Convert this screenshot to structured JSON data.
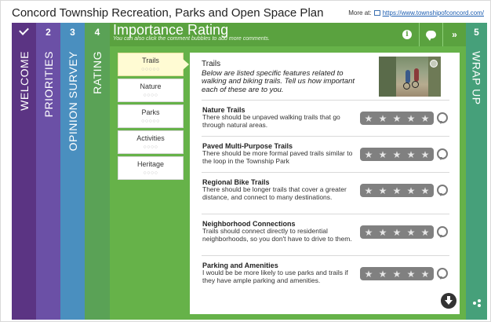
{
  "app": {
    "title": "Concord Township Recreation, Parks and Open Space Plan",
    "more_at_label": "More at:",
    "more_at_link": "https://www.townshipofconcord.com/"
  },
  "tabs": [
    {
      "num": "",
      "label": "WELCOME",
      "icon": "check-icon",
      "color": "#5b3483"
    },
    {
      "num": "2",
      "label": "PRIORITIES",
      "color": "#6b50a6"
    },
    {
      "num": "3",
      "label": "OPINION SURVEY",
      "color": "#4a8fbf"
    },
    {
      "num": "4",
      "label": "RATING",
      "color": "#5aa256"
    },
    {
      "num": "5",
      "label": "WRAP UP",
      "color": "#46a07a"
    }
  ],
  "main": {
    "title": "Importance Rating",
    "subtitle": "You can also click the comment bubbles to add more comments.",
    "header_icons": [
      "info-icon",
      "comment-icon",
      "forward-icon"
    ],
    "forward_glyph": "»"
  },
  "categories": [
    {
      "label": "Trails",
      "dots": "○○○○○",
      "active": true
    },
    {
      "label": "Nature",
      "dots": "○○○○",
      "active": false
    },
    {
      "label": "Parks",
      "dots": "○○○○○",
      "active": false
    },
    {
      "label": "Activities",
      "dots": "○○○○",
      "active": false
    },
    {
      "label": "Heritage",
      "dots": "○○○○",
      "active": false
    }
  ],
  "panel": {
    "title": "Trails",
    "description": "Below are listed specific features related to walking and biking trails. Tell us how important each of these are to you.",
    "items": [
      {
        "name": "Nature Trails",
        "desc": "There should be unpaved walking trails that go through natural areas.",
        "rating": 0,
        "max": 5
      },
      {
        "name": "Paved Multi-Purpose Trails",
        "desc": "There should be more formal paved trails similar to the loop in the Township Park",
        "rating": 0,
        "max": 5
      },
      {
        "name": "Regional Bike Trails",
        "desc": "There should be longer trails that cover a greater distance, and connect to many destinations.",
        "rating": 0,
        "max": 5
      },
      {
        "name": "Neighborhood Connections",
        "desc": "Trails should connect directly to residential neighborhoods, so you don't have to drive to them.",
        "rating": 0,
        "max": 5
      },
      {
        "name": "Parking and Amenities",
        "desc": "I would be be more likely to use parks and trails if they have ample parking and amenities.",
        "rating": 0,
        "max": 5
      }
    ],
    "star_glyph": "★"
  },
  "colors": {
    "rating_tab": "#5aa256",
    "main_bg": "#66b249",
    "active_category": "#fffbd3",
    "star_bar": "#808080"
  }
}
